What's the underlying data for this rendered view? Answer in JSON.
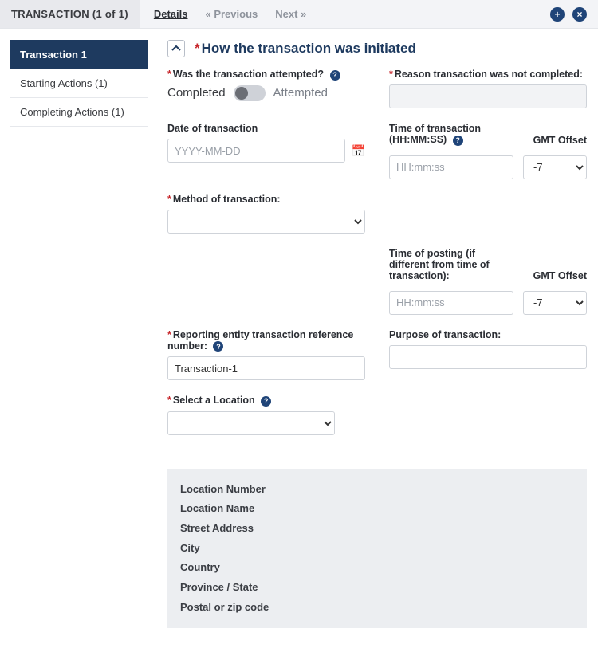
{
  "topbar": {
    "title": "TRANSACTION (1 of 1)",
    "details": "Details",
    "prev": "«  Previous",
    "next": "Next  »"
  },
  "sidebar": {
    "items": [
      {
        "label": "Transaction 1"
      },
      {
        "label": "Starting Actions (1)"
      },
      {
        "label": "Completing Actions (1)"
      }
    ]
  },
  "section": {
    "title": "How the transaction was initiated"
  },
  "fields": {
    "attempted_label": "Was the transaction attempted?",
    "completed": "Completed",
    "attempted": "Attempted",
    "reason_label": "Reason transaction was not completed:",
    "date_label": "Date of transaction",
    "date_placeholder": "YYYY-MM-DD",
    "time_label": "Time of transaction (HH:MM:SS)",
    "time_placeholder": "HH:mm:ss",
    "gmt_label": "GMT Offset",
    "gmt_value": "-7",
    "method_label": "Method of transaction:",
    "posting_label": "Time of posting (if different from time of transaction):",
    "ref_label": "Reporting entity transaction reference number:",
    "ref_value": "Transaction-1",
    "purpose_label": "Purpose of transaction:",
    "location_label": "Select a Location"
  },
  "location_box": {
    "number": "Location Number",
    "name": "Location Name",
    "street": "Street Address",
    "city": "City",
    "country": "Country",
    "province": "Province / State",
    "postal": "Postal or zip code"
  }
}
